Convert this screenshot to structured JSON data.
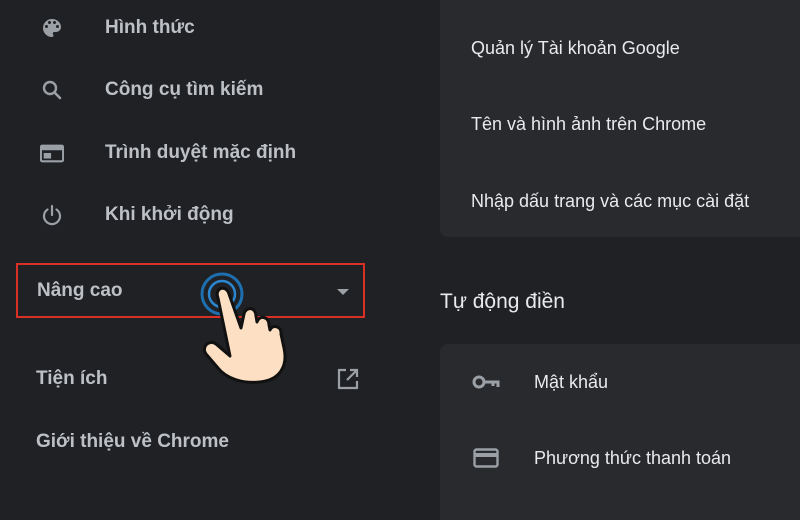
{
  "sidebar": {
    "items": [
      {
        "label": "Hình thức",
        "icon": "palette-icon"
      },
      {
        "label": "Công cụ tìm kiếm",
        "icon": "search-icon"
      },
      {
        "label": "Trình duyệt mặc định",
        "icon": "browser-window-icon"
      },
      {
        "label": "Khi khởi động",
        "icon": "power-icon"
      }
    ],
    "advanced_label": "Nâng cao",
    "extensions_label": "Tiện ích",
    "about_label": "Giới thiệu về Chrome"
  },
  "main": {
    "you_and_google_rows": [
      "Quản lý Tài khoản Google",
      "Tên và hình ảnh trên Chrome",
      "Nhập dấu trang và các mục cài đặt"
    ],
    "autofill_title": "Tự động điền",
    "autofill_rows": [
      {
        "label": "Mật khẩu",
        "icon": "key-icon"
      },
      {
        "label": "Phương thức thanh toán",
        "icon": "credit-card-icon"
      }
    ]
  },
  "colors": {
    "background": "#202124",
    "card": "#292a2d",
    "highlight_border": "#d93025",
    "text": "#e8eaed",
    "muted": "#9aa0a6"
  }
}
